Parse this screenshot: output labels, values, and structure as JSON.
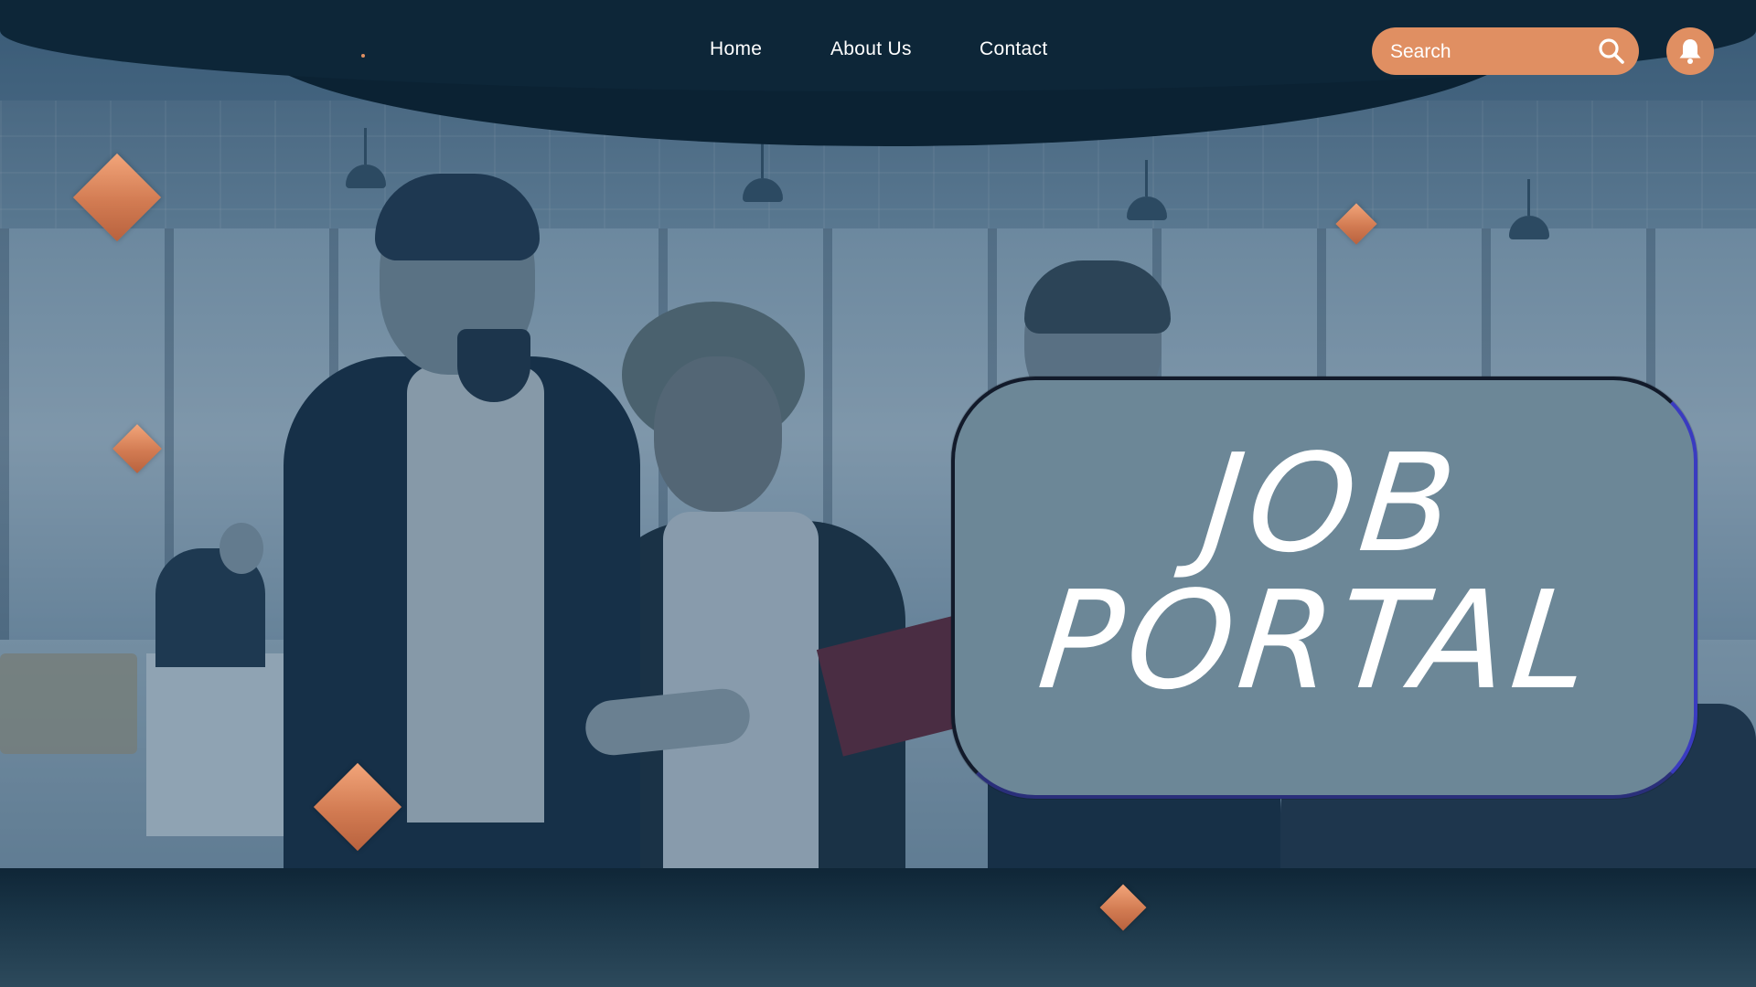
{
  "nav": {
    "links": [
      {
        "label": "Home"
      },
      {
        "label": "About Us"
      },
      {
        "label": "Contact"
      }
    ],
    "search": {
      "placeholder": "Search"
    },
    "icons": {
      "search": "search-icon",
      "notifications": "bell-icon"
    }
  },
  "hero": {
    "title_line1": "JOB",
    "title_line2": "PORTAL"
  },
  "colors": {
    "accent": "#e08f62",
    "card": "#6c8797",
    "overlay": "#0d2638"
  }
}
